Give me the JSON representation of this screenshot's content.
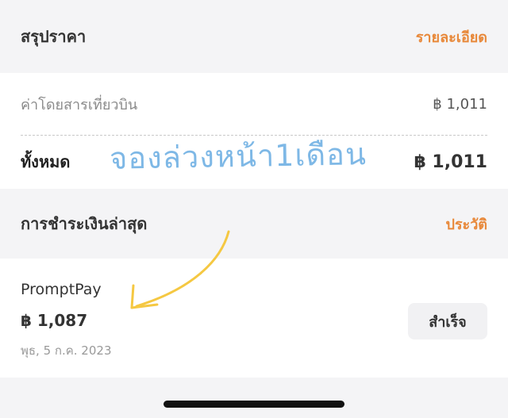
{
  "summary": {
    "title": "สรุปราคา",
    "detail_link": "รายละเอียด",
    "fare_label": "ค่าโดยสารเที่ยวบิน",
    "fare_amount": "฿ 1,011",
    "total_label": "ทั้งหมด",
    "total_amount": "฿ 1,011"
  },
  "annotation": {
    "handwritten_text": "จองล่วงหน้า1เดือน",
    "handwriting_color": "#7eb8e6",
    "arrow_color": "#f5c842"
  },
  "latest_payment": {
    "title": "การชำระเงินล่าสุด",
    "history_link": "ประวัติ",
    "method": "PromptPay",
    "amount": "฿ 1,087",
    "date": "พุธ, 5 ก.ค. 2023",
    "status": "สำเร็จ"
  },
  "colors": {
    "accent": "#e8893b",
    "background": "#f4f4f6",
    "card": "#ffffff"
  }
}
